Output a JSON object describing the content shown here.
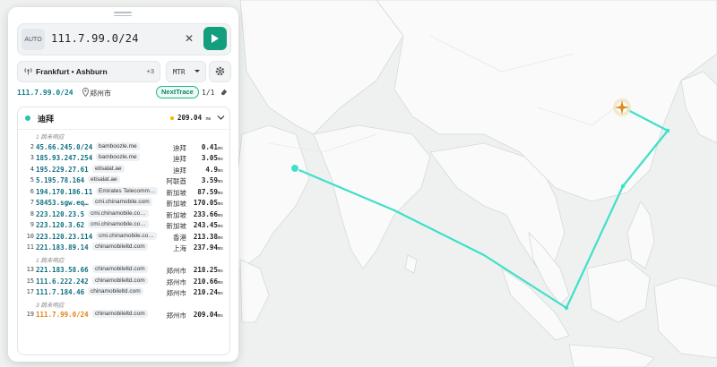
{
  "search": {
    "mode": "AUTO",
    "query": "111.7.99.0/24",
    "clear": "✕"
  },
  "nodes": {
    "label": "Frankfurt • Ashburn",
    "extra_count": "+3"
  },
  "protocol": {
    "selected": "MTR"
  },
  "target_info": {
    "target": "111.7.99.0/24",
    "city": "郑州市",
    "badge": "NextTrace",
    "page": "1/1"
  },
  "destination": {
    "name": "迪拜",
    "latency": "209.04",
    "unit": "ms"
  },
  "hops": [
    {
      "note": "1 跳未响应"
    },
    {
      "n": "2",
      "ip": "45.66.245.0/24",
      "host": "bamboozle.me",
      "loc": "迪拜",
      "ms": "0.41",
      "unit": "ms"
    },
    {
      "n": "3",
      "ip": "185.93.247.254",
      "host": "bamboozle.me",
      "loc": "迪拜",
      "ms": "3.05",
      "unit": "ms"
    },
    {
      "n": "4",
      "ip": "195.229.27.61",
      "host": "etisalat.ae",
      "loc": "迪拜",
      "ms": "4.9",
      "unit": "ms"
    },
    {
      "n": "5",
      "ip": "5.195.78.164",
      "host": "etisalat.ae",
      "loc": "阿联酋",
      "ms": "3.59",
      "unit": "ms"
    },
    {
      "n": "6",
      "ip": "194.170.186.11",
      "host": "Emirates Telecomm…",
      "loc": "新加坡",
      "ms": "87.59",
      "unit": "ms"
    },
    {
      "n": "7",
      "ip": "58453.sgw.eq…",
      "host": "cmi.chinamobile.com",
      "loc": "新加坡",
      "ms": "170.05",
      "unit": "ms"
    },
    {
      "n": "8",
      "ip": "223.120.23.5",
      "host": "cmi.chinamobile.co…",
      "loc": "新加坡",
      "ms": "233.66",
      "unit": "ms"
    },
    {
      "n": "9",
      "ip": "223.120.3.62",
      "host": "cmi.chinamobile.co…",
      "loc": "新加坡",
      "ms": "243.45",
      "unit": "ms"
    },
    {
      "n": "10",
      "ip": "223.120.23.114",
      "host": "cmi.chinamobile.co…",
      "loc": "香港",
      "ms": "213.38",
      "unit": "ms"
    },
    {
      "n": "11",
      "ip": "221.183.89.14",
      "host": "chinamobileltd.com",
      "loc": "上海",
      "ms": "237.94",
      "unit": "ms"
    },
    {
      "note": "1 跳未响应"
    },
    {
      "n": "13",
      "ip": "221.183.58.66",
      "host": "chinamobileltd.com",
      "loc": "郑州市",
      "ms": "218.25",
      "unit": "ms"
    },
    {
      "n": "15",
      "ip": "111.6.222.242",
      "host": "chinamobileltd.com",
      "loc": "郑州市",
      "ms": "210.66",
      "unit": "ms"
    },
    {
      "n": "17",
      "ip": "111.7.184.46",
      "host": "chinamobileltd.com",
      "loc": "郑州市",
      "ms": "210.24",
      "unit": "ms"
    },
    {
      "note": "3 跳未响应"
    },
    {
      "n": "19",
      "ip": "111.7.99.0/24",
      "host": "chinamobileltd.com",
      "loc": "郑州市",
      "ms": "209.04",
      "unit": "ms",
      "final": true
    }
  ],
  "colors": {
    "accent": "#139e7e",
    "route": "#3fe0c8",
    "final_ip": "#e4820d",
    "ip": "#0f6e80"
  },
  "icons": [
    "antenna-icon",
    "play-icon",
    "close-icon",
    "gear-icon",
    "location-pin-icon",
    "eraser-icon",
    "chevron-down-icon",
    "compass-marker-icon"
  ]
}
